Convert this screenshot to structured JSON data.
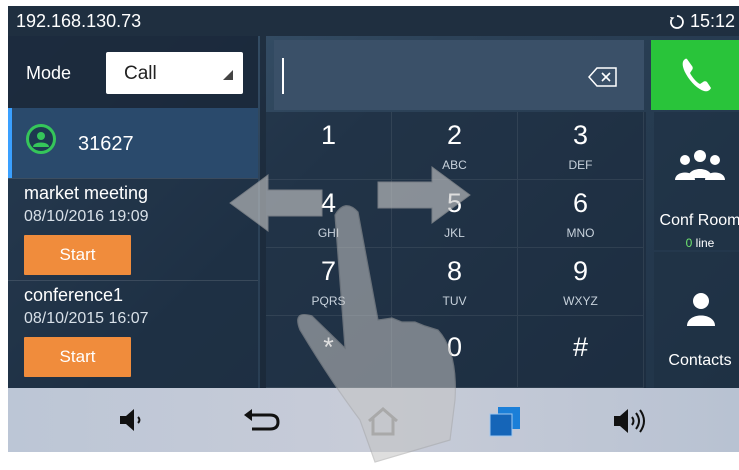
{
  "status": {
    "ip": "192.168.130.73",
    "time": "15:12",
    "sync_icon": "sync-icon"
  },
  "mode": {
    "label": "Mode",
    "value": "Call"
  },
  "account": {
    "number": "31627",
    "icon": "user-icon"
  },
  "meetings": [
    {
      "title": "market meeting",
      "datetime": "08/10/2016 19:09",
      "button": "Start"
    },
    {
      "title": "conference1",
      "datetime": "08/10/2015 16:07",
      "button": "Start"
    }
  ],
  "keypad": [
    {
      "digit": "1",
      "letters": ""
    },
    {
      "digit": "2",
      "letters": "ABC"
    },
    {
      "digit": "3",
      "letters": "DEF"
    },
    {
      "digit": "4",
      "letters": "GHI"
    },
    {
      "digit": "5",
      "letters": "JKL"
    },
    {
      "digit": "6",
      "letters": "MNO"
    },
    {
      "digit": "7",
      "letters": "PQRS"
    },
    {
      "digit": "8",
      "letters": "TUV"
    },
    {
      "digit": "9",
      "letters": "WXYZ"
    },
    {
      "digit": "*",
      "letters": ""
    },
    {
      "digit": "0",
      "letters": ""
    },
    {
      "digit": "#",
      "letters": ""
    }
  ],
  "side": {
    "conf_room": {
      "label": "Conf Room",
      "count": "0",
      "suffix": "line"
    },
    "contacts": {
      "label": "Contacts"
    }
  },
  "colors": {
    "call_green": "#29c43a",
    "start_orange": "#f08c3c",
    "account_green": "#35c65a"
  },
  "navbar": [
    "volume-down-icon",
    "back-icon",
    "home-icon",
    "recent-apps-icon",
    "volume-up-icon"
  ]
}
